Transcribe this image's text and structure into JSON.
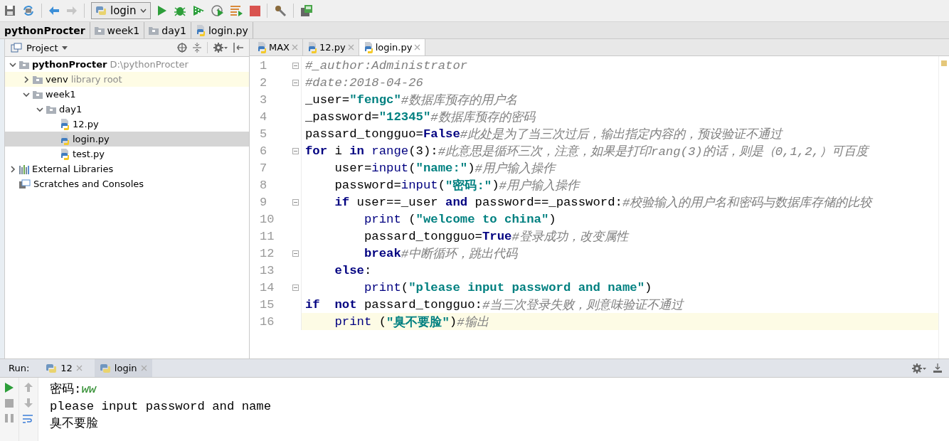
{
  "toolbar": {
    "run_config": "login"
  },
  "breadcrumbs": [
    {
      "label": "pythonProcter",
      "kind": "project"
    },
    {
      "label": "week1",
      "kind": "folder"
    },
    {
      "label": "day1",
      "kind": "folder"
    },
    {
      "label": "login.py",
      "kind": "file"
    }
  ],
  "project_panel": {
    "title": "Project",
    "tree": [
      {
        "name": "pythonProcter",
        "hint": "D:\\pythonProcter",
        "kind": "root",
        "expanded": true,
        "selected": false,
        "children": [
          {
            "name": "venv",
            "hint": "library root",
            "kind": "library",
            "expanded": false,
            "selected": false
          },
          {
            "name": "week1",
            "kind": "folder",
            "expanded": true,
            "selected": false,
            "children": [
              {
                "name": "day1",
                "kind": "folder",
                "expanded": true,
                "selected": false,
                "children": [
                  {
                    "name": "12.py",
                    "kind": "file",
                    "selected": false
                  },
                  {
                    "name": "login.py",
                    "kind": "file",
                    "selected": true
                  },
                  {
                    "name": "test.py",
                    "kind": "file",
                    "selected": false
                  }
                ]
              }
            ]
          }
        ]
      },
      {
        "name": "External Libraries",
        "kind": "libraries",
        "expanded": false,
        "selected": false
      },
      {
        "name": "Scratches and Consoles",
        "kind": "scratches",
        "selected": false
      }
    ]
  },
  "editor": {
    "tabs": [
      {
        "label": "MAX",
        "selected": false
      },
      {
        "label": "12.py",
        "selected": false
      },
      {
        "label": "login.py",
        "selected": true
      }
    ],
    "lines": [
      {
        "number": "1",
        "fold": true,
        "current": false,
        "tokens": [
          {
            "kind": "cm",
            "text": "#_author:Administrator"
          }
        ]
      },
      {
        "number": "2",
        "fold": true,
        "current": false,
        "tokens": [
          {
            "kind": "cm",
            "text": "#date:2018-04-26"
          }
        ]
      },
      {
        "number": "3",
        "fold": false,
        "current": false,
        "tokens": [
          {
            "kind": "tx",
            "text": "_user="
          },
          {
            "kind": "str",
            "text": "\"fengc\""
          },
          {
            "kind": "cm",
            "text": "#数据库预存的用户名"
          }
        ]
      },
      {
        "number": "4",
        "fold": false,
        "current": false,
        "tokens": [
          {
            "kind": "tx",
            "text": "_password="
          },
          {
            "kind": "str",
            "text": "\"12345\""
          },
          {
            "kind": "cm",
            "text": "#数据库预存的密码"
          }
        ]
      },
      {
        "number": "5",
        "fold": false,
        "current": false,
        "tokens": [
          {
            "kind": "tx",
            "text": "passard_tongguo="
          },
          {
            "kind": "kw",
            "text": "False"
          },
          {
            "kind": "cm",
            "text": "#此处是为了当三次过后，输出指定内容的，预设验证不通过"
          }
        ]
      },
      {
        "number": "6",
        "fold": true,
        "current": false,
        "tokens": [
          {
            "kind": "kw",
            "text": "for"
          },
          {
            "kind": "tx",
            "text": " i "
          },
          {
            "kind": "kw",
            "text": "in"
          },
          {
            "kind": "bi",
            "text": " range"
          },
          {
            "kind": "tx",
            "text": "(3):"
          },
          {
            "kind": "cm",
            "text": "#此意思是循环三次，注意，如果是打印rang(3)的话，则是（0,1,2,）可百度"
          }
        ]
      },
      {
        "number": "7",
        "fold": false,
        "current": false,
        "tokens": [
          {
            "kind": "tx",
            "text": "    user="
          },
          {
            "kind": "bi",
            "text": "input"
          },
          {
            "kind": "tx",
            "text": "("
          },
          {
            "kind": "str",
            "text": "\"name:\""
          },
          {
            "kind": "tx",
            "text": ")"
          },
          {
            "kind": "cm",
            "text": "#用户输入操作"
          }
        ]
      },
      {
        "number": "8",
        "fold": false,
        "current": false,
        "tokens": [
          {
            "kind": "tx",
            "text": "    password="
          },
          {
            "kind": "bi",
            "text": "input"
          },
          {
            "kind": "tx",
            "text": "("
          },
          {
            "kind": "str",
            "text": "\"密码:\""
          },
          {
            "kind": "tx",
            "text": ")"
          },
          {
            "kind": "cm",
            "text": "#用户输入操作"
          }
        ]
      },
      {
        "number": "9",
        "fold": true,
        "current": false,
        "tokens": [
          {
            "kind": "kw",
            "text": "    if"
          },
          {
            "kind": "tx",
            "text": " user==_user "
          },
          {
            "kind": "kw",
            "text": "and"
          },
          {
            "kind": "tx",
            "text": " password==_password:"
          },
          {
            "kind": "cm",
            "text": "#校验输入的用户名和密码与数据库存储的比较"
          }
        ]
      },
      {
        "number": "10",
        "fold": false,
        "current": false,
        "tokens": [
          {
            "kind": "bi",
            "text": "        print"
          },
          {
            "kind": "tx",
            "text": " ("
          },
          {
            "kind": "str",
            "text": "\"welcome to china\""
          },
          {
            "kind": "tx",
            "text": ")"
          }
        ]
      },
      {
        "number": "11",
        "fold": false,
        "current": false,
        "tokens": [
          {
            "kind": "tx",
            "text": "        passard_tongguo="
          },
          {
            "kind": "kw",
            "text": "True"
          },
          {
            "kind": "cm",
            "text": "#登录成功，改变属性"
          }
        ]
      },
      {
        "number": "12",
        "fold": true,
        "current": false,
        "tokens": [
          {
            "kind": "kw",
            "text": "        break"
          },
          {
            "kind": "cm",
            "text": "#中断循环，跳出代码"
          }
        ]
      },
      {
        "number": "13",
        "fold": false,
        "current": false,
        "tokens": [
          {
            "kind": "kw",
            "text": "    else"
          },
          {
            "kind": "tx",
            "text": ":"
          }
        ]
      },
      {
        "number": "14",
        "fold": true,
        "current": false,
        "tokens": [
          {
            "kind": "bi",
            "text": "        print"
          },
          {
            "kind": "tx",
            "text": "("
          },
          {
            "kind": "str",
            "text": "\"please input password and name\""
          },
          {
            "kind": "tx",
            "text": ")"
          }
        ]
      },
      {
        "number": "15",
        "fold": false,
        "current": false,
        "tokens": [
          {
            "kind": "kw",
            "text": "if"
          },
          {
            "kind": "kw",
            "text": "  not"
          },
          {
            "kind": "tx",
            "text": " passard_tongguo:"
          },
          {
            "kind": "cm",
            "text": "#当三次登录失败，则意味验证不通过"
          }
        ]
      },
      {
        "number": "16",
        "fold": false,
        "current": true,
        "tokens": [
          {
            "kind": "bi",
            "text": "    print"
          },
          {
            "kind": "tx",
            "text": " ("
          },
          {
            "kind": "str",
            "text": "\"臭不要脸\""
          },
          {
            "kind": "tx",
            "text": ")"
          },
          {
            "kind": "cm",
            "text": "#输出"
          }
        ]
      }
    ]
  },
  "run_panel": {
    "label": "Run:",
    "tabs": [
      {
        "label": "12",
        "selected": false
      },
      {
        "label": "login",
        "selected": true
      }
    ],
    "output": [
      {
        "parts": [
          {
            "kind": "out",
            "text": "密码:"
          },
          {
            "kind": "input",
            "text": "ww"
          }
        ]
      },
      {
        "parts": [
          {
            "kind": "out",
            "text": "please input password and name"
          }
        ]
      },
      {
        "parts": [
          {
            "kind": "out",
            "text": "臭不要脸"
          }
        ]
      }
    ]
  }
}
